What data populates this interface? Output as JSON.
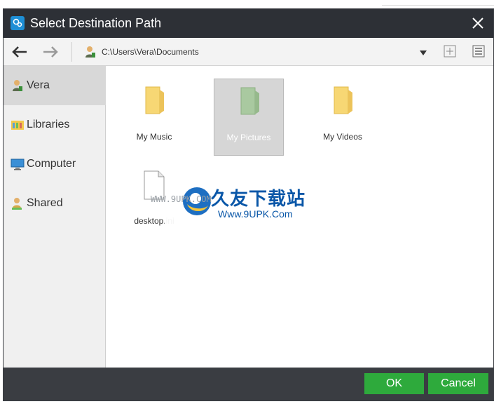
{
  "window": {
    "title": "Select Destination Path"
  },
  "toolbar": {
    "path": "C:\\Users\\Vera\\Documents"
  },
  "sidebar": {
    "items": [
      {
        "label": "Vera",
        "icon": "user-icon",
        "selected": true
      },
      {
        "label": "Libraries",
        "icon": "libraries-icon"
      },
      {
        "label": "Computer",
        "icon": "computer-icon"
      },
      {
        "label": "Shared",
        "icon": "shared-icon"
      }
    ]
  },
  "content": {
    "items": [
      {
        "label": "My Music",
        "type": "folder"
      },
      {
        "label": "My Pictures",
        "type": "folder",
        "selected": true
      },
      {
        "label": "My Videos",
        "type": "folder"
      },
      {
        "label": "desktop.ini",
        "type": "file"
      }
    ]
  },
  "watermark": {
    "cn": "久友下载站",
    "url": "Www.9UPK.Com",
    "small": "WWW.9UPK.COM"
  },
  "footer": {
    "ok_label": "OK",
    "cancel_label": "Cancel"
  },
  "colors": {
    "titlebar": "#2d3036",
    "accent_green": "#2eaa3c",
    "footer": "#3a3d42",
    "folder": "#f7d774"
  }
}
